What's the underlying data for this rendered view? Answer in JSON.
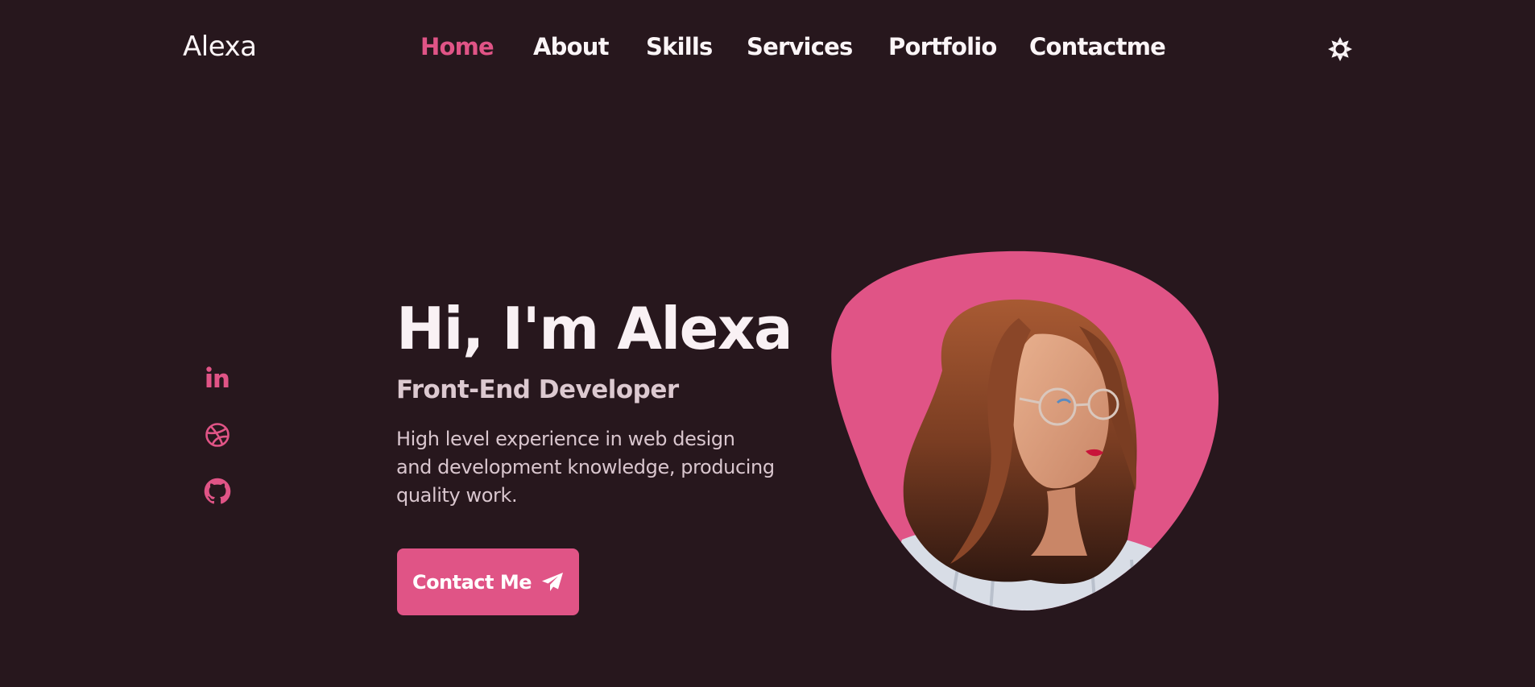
{
  "header": {
    "logo": "Alexa",
    "nav": [
      {
        "label": "Home",
        "active": true
      },
      {
        "label": "About"
      },
      {
        "label": "Skills"
      },
      {
        "label": "Services"
      },
      {
        "label": "Portfolio"
      },
      {
        "label": "Contactme"
      }
    ],
    "theme_icon": "sun-icon"
  },
  "social": [
    {
      "icon": "linkedin-icon"
    },
    {
      "icon": "dribbble-icon"
    },
    {
      "icon": "github-icon"
    }
  ],
  "hero": {
    "title": "Hi, I'm Alexa",
    "subtitle": "Front-End Developer",
    "description": "High level experience in web design and development knowledge, producing quality work.",
    "button_label": "Contact Me",
    "button_icon": "send-icon",
    "image": "profile-photo"
  },
  "colors": {
    "background": "#27171d",
    "accent": "#e05486",
    "text": "#fbf5f7"
  }
}
